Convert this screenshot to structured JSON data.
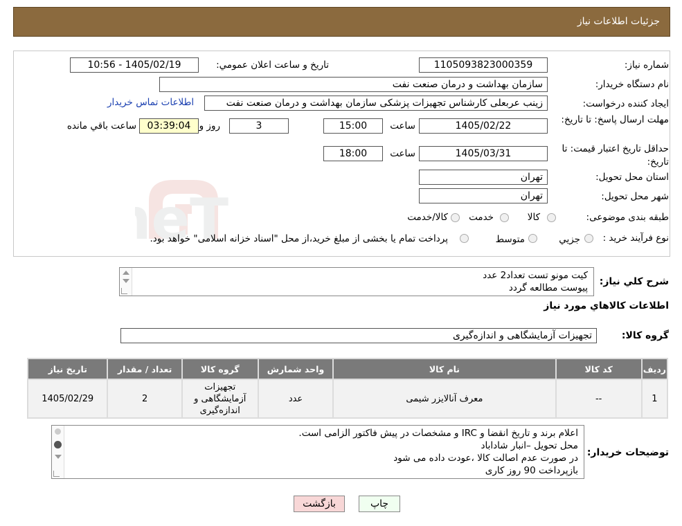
{
  "header": {
    "title": "جزئیات اطلاعات نیاز"
  },
  "form": {
    "need_number_label": "شماره نیاز:",
    "need_number": "1105093823000359",
    "announce_label": "تاریخ و ساعت اعلان عمومي:",
    "announce_value": "1405/02/19 - 10:56",
    "buyer_org_label": "نام دستگاه خريدار:",
    "buyer_org": "سازمان بهداشت و درمان صنعت نفت",
    "requester_label": "ايجاد کننده درخواست:",
    "requester": "زینب عربعلی کارشناس تجهیزات پزشکی سازمان بهداشت و درمان صنعت نفت",
    "contact_link": "اطلاعات تماس خريدار",
    "deadline_label": "مهلت ارسال پاسخ: تا تاريخ:",
    "deadline_date": "1405/02/22",
    "time_label": "ساعت",
    "deadline_time": "15:00",
    "days": "3",
    "days_label": "روز و",
    "remaining": "03:39:04",
    "remaining_label": "ساعت باقي مانده",
    "validity_label": "حداقل تاريخ اعتبار قيمت: تا تاريخ:",
    "validity_date": "1405/03/31",
    "validity_time": "18:00",
    "province_label": "استان محل تحويل:",
    "province": "تهران",
    "city_label": "شهر محل تحويل:",
    "city": "تهران",
    "category_label": "طبقه بندی موضوعی:",
    "category_options": [
      "کالا",
      "خدمت",
      "کالا/خدمت"
    ],
    "process_label": "نوع فرآيند خريد :",
    "process_options": [
      "جزيي",
      "متوسط"
    ],
    "process_note": "پرداخت تمام يا بخشی از مبلغ خريد،از محل \"اسناد خزانه اسلامی\" خواهد بود."
  },
  "summary": {
    "label": "شرح کلي نياز:",
    "lines": [
      "کیت مونو تست  تعداد2 عدد",
      "پیوست مطالعه گردد"
    ]
  },
  "goods_section": {
    "title": "اطلاعات کالاهاي مورد نياز",
    "group_label": "گروه کالا:",
    "group_value": "تجهیزات آزمایشگاهی و اندازه‌گیری"
  },
  "table": {
    "headers": [
      "رديف",
      "کد کالا",
      "نام کالا",
      "واحد شمارش",
      "گروه کالا",
      "تعداد / مقدار",
      "تاريخ نياز"
    ],
    "rows": [
      [
        "1",
        "--",
        "معرف آنالایزر شیمی",
        "عدد",
        "تجهیزات آزمایشگاهی و اندازه‌گیری",
        "2",
        "1405/02/29"
      ]
    ]
  },
  "buyer_notes": {
    "label": "توضيحات خريدار:",
    "lines": [
      "اعلام برند و تاریخ انقضا  و IRC  و مشخصات  در پیش فاکتور الزامی است.",
      "محل تحویل –انبار شاداباد",
      "در صورت عدم اصالت کالا ،عودت داده می شود",
      "بازپرداخت 90 روز کاری"
    ]
  },
  "buttons": {
    "print": "چاپ",
    "back": "بازگشت"
  },
  "watermark": {
    "text": "AriaTender.neT"
  },
  "colors": {
    "header_bg": "#8b6a3e",
    "link": "#1a3fb0",
    "table_header": "#7a7a7a",
    "back_button": "#f8d7d7",
    "print_button": "#f0fff0"
  }
}
